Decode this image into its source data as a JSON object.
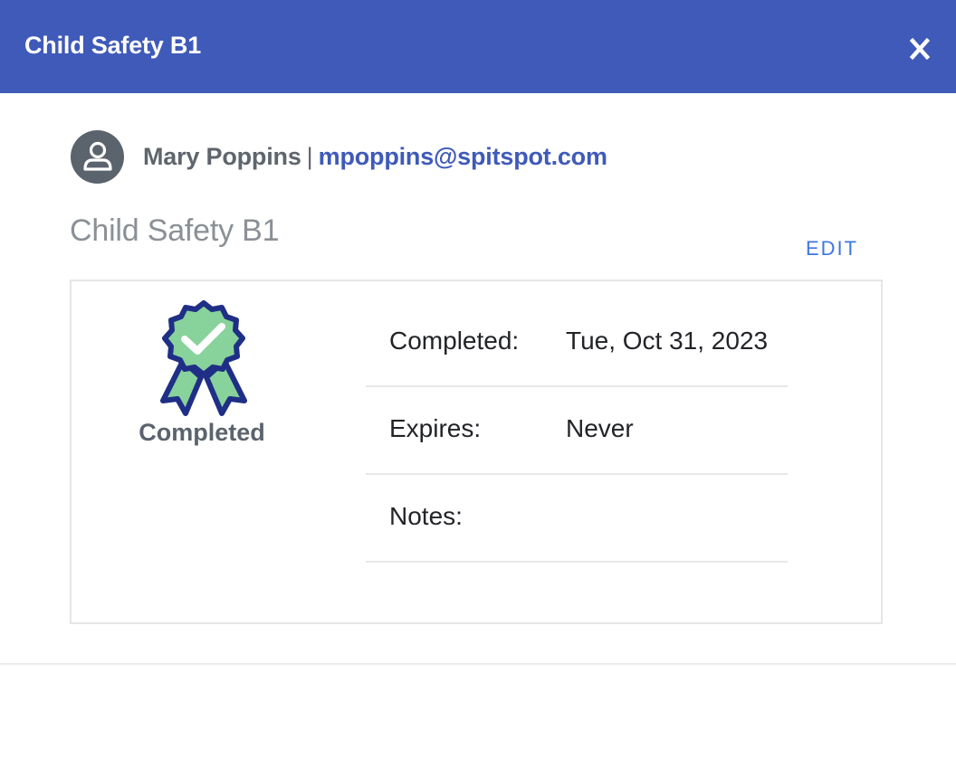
{
  "header": {
    "title": "Child Safety B1",
    "close_label": "x"
  },
  "user": {
    "name": "Mary Poppins",
    "separator": "|",
    "email": "mpoppins@spitspot.com",
    "avatar_icon": "user-icon"
  },
  "course": {
    "title": "Child Safety B1",
    "edit_label": "EDIT"
  },
  "status": {
    "badge_icon": "award-ribbon-check-icon",
    "label": "Completed"
  },
  "details": [
    {
      "label": "Completed:",
      "value": "Tue, Oct 31, 2023"
    },
    {
      "label": "Expires:",
      "value": "Never"
    },
    {
      "label": "Notes:",
      "value": ""
    }
  ],
  "colors": {
    "header_bg": "#3f5ab8",
    "link": "#3f5ab8",
    "edit": "#3f76dc",
    "badge_fill": "#88d29b",
    "badge_stroke": "#1f2f86"
  }
}
